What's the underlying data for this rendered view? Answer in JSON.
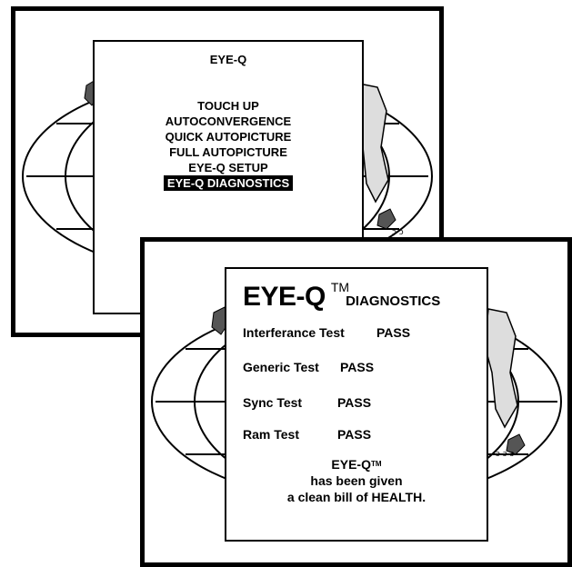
{
  "back_screen": {
    "menu_title": "EYE-Q",
    "menu_items": [
      {
        "label": "TOUCH UP",
        "selected": false
      },
      {
        "label": "AUTOCONVERGENCE",
        "selected": false
      },
      {
        "label": "QUICK AUTOPICTURE",
        "selected": false
      },
      {
        "label": "FULL AUTOPICTURE",
        "selected": false
      },
      {
        "label": "EYE-Q SETUP",
        "selected": false
      },
      {
        "label": "EYE-Q DIAGNOSTICS",
        "selected": true
      }
    ]
  },
  "front_screen": {
    "brand": "EYE-Q",
    "trademark": "TM",
    "heading": "DIAGNOSTICS",
    "tests": [
      {
        "name": "Interferance Test",
        "result": "PASS"
      },
      {
        "name": "Generic Test",
        "result": "PASS"
      },
      {
        "name": "Sync Test",
        "result": "PASS"
      },
      {
        "name": "Ram Test",
        "result": "PASS"
      }
    ],
    "footer_brand": "EYE-Q",
    "footer_trademark": "TM",
    "footer_line1": "has been given",
    "footer_line2": "a clean bill of HEALTH."
  },
  "colors": {
    "foreground": "#000000",
    "background": "#ffffff",
    "selection": "#000000"
  }
}
